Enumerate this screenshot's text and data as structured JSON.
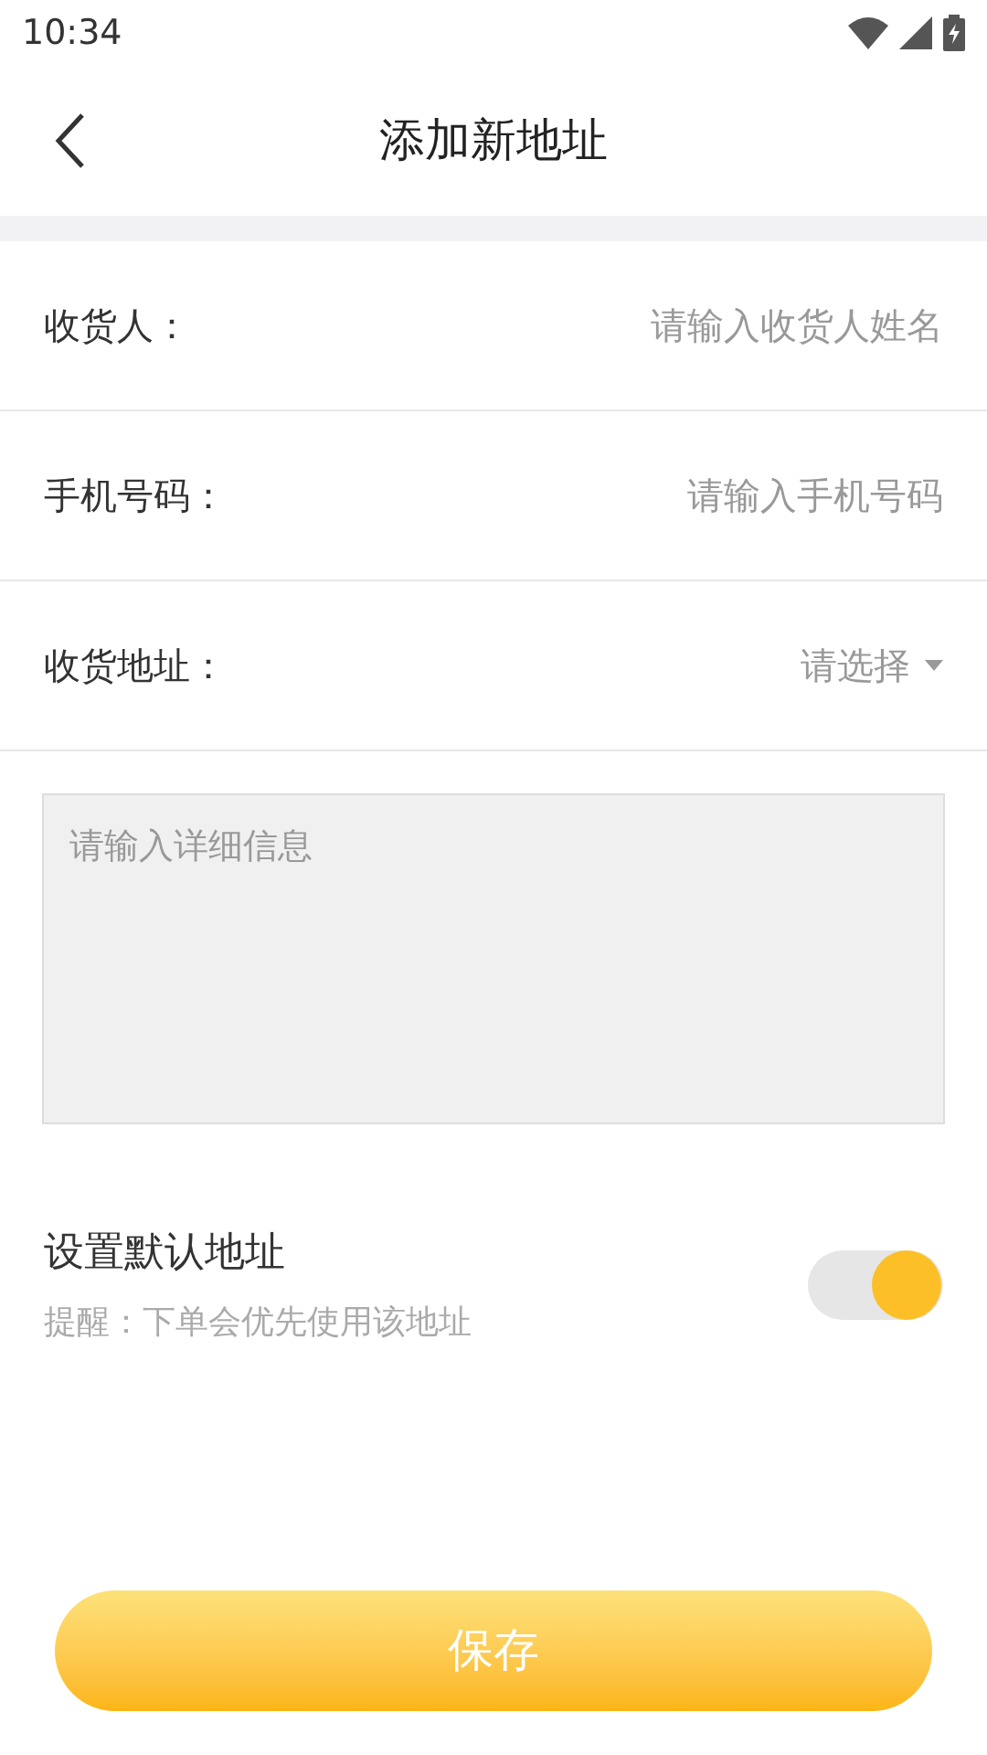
{
  "status_bar": {
    "time": "10:34"
  },
  "header": {
    "title": "添加新地址"
  },
  "fields": [
    {
      "kind": "input",
      "label": "收货人：",
      "placeholder": "请输入收货人姓名"
    },
    {
      "kind": "input",
      "label": "手机号码：",
      "placeholder": "请输入手机号码"
    },
    {
      "kind": "select",
      "label": "收货地址：",
      "placeholder": "请选择"
    }
  ],
  "detail": {
    "placeholder": "请输入详细信息"
  },
  "default_address": {
    "title": "设置默认地址",
    "hint": "提醒：下单会优先使用该地址",
    "on": true
  },
  "save_button": {
    "label": "保存"
  }
}
